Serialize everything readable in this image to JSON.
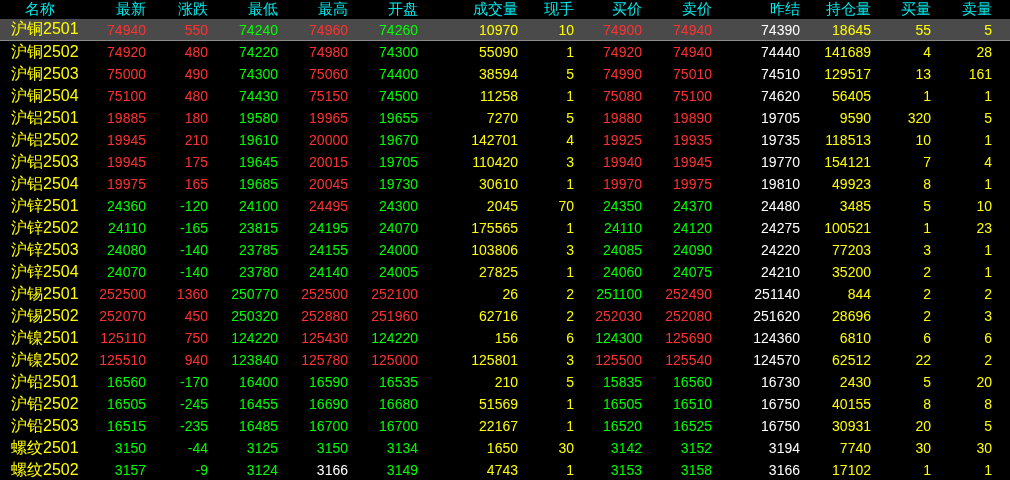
{
  "table": {
    "columns": [
      "名称",
      "最新",
      "涨跌",
      "最低",
      "最高",
      "开盘",
      "成交量",
      "现手",
      "买价",
      "卖价",
      "昨结",
      "持仓量",
      "买量",
      "卖量"
    ],
    "rows": [
      {
        "selected": true,
        "cells": [
          {
            "text": "沪铜2501"
          },
          {
            "text": "74940",
            "color": "#ff3232"
          },
          {
            "text": "550",
            "color": "#ff3232"
          },
          {
            "text": "74240",
            "color": "#00ff00"
          },
          {
            "text": "74960",
            "color": "#ff3232"
          },
          {
            "text": "74260",
            "color": "#00ff00"
          },
          {
            "text": "10970",
            "color": "#ffff00"
          },
          {
            "text": "10",
            "color": "#ffff00"
          },
          {
            "text": "74900",
            "color": "#ff3232"
          },
          {
            "text": "74940",
            "color": "#ff3232"
          },
          {
            "text": "74390",
            "color": "#ffffff"
          },
          {
            "text": "18645",
            "color": "#ffff00"
          },
          {
            "text": "55",
            "color": "#ffff00"
          },
          {
            "text": "5",
            "color": "#ffff00"
          }
        ]
      },
      {
        "selected": false,
        "cells": [
          {
            "text": "沪铜2502"
          },
          {
            "text": "74920",
            "color": "#ff3232"
          },
          {
            "text": "480",
            "color": "#ff3232"
          },
          {
            "text": "74220",
            "color": "#00ff00"
          },
          {
            "text": "74980",
            "color": "#ff3232"
          },
          {
            "text": "74300",
            "color": "#00ff00"
          },
          {
            "text": "55090",
            "color": "#ffff00"
          },
          {
            "text": "1",
            "color": "#ffff00"
          },
          {
            "text": "74920",
            "color": "#ff3232"
          },
          {
            "text": "74940",
            "color": "#ff3232"
          },
          {
            "text": "74440",
            "color": "#ffffff"
          },
          {
            "text": "141689",
            "color": "#ffff00"
          },
          {
            "text": "4",
            "color": "#ffff00"
          },
          {
            "text": "28",
            "color": "#ffff00"
          }
        ]
      },
      {
        "selected": false,
        "cells": [
          {
            "text": "沪铜2503"
          },
          {
            "text": "75000",
            "color": "#ff3232"
          },
          {
            "text": "490",
            "color": "#ff3232"
          },
          {
            "text": "74300",
            "color": "#00ff00"
          },
          {
            "text": "75060",
            "color": "#ff3232"
          },
          {
            "text": "74400",
            "color": "#00ff00"
          },
          {
            "text": "38594",
            "color": "#ffff00"
          },
          {
            "text": "5",
            "color": "#ffff00"
          },
          {
            "text": "74990",
            "color": "#ff3232"
          },
          {
            "text": "75010",
            "color": "#ff3232"
          },
          {
            "text": "74510",
            "color": "#ffffff"
          },
          {
            "text": "129517",
            "color": "#ffff00"
          },
          {
            "text": "13",
            "color": "#ffff00"
          },
          {
            "text": "161",
            "color": "#ffff00"
          }
        ]
      },
      {
        "selected": false,
        "cells": [
          {
            "text": "沪铜2504"
          },
          {
            "text": "75100",
            "color": "#ff3232"
          },
          {
            "text": "480",
            "color": "#ff3232"
          },
          {
            "text": "74430",
            "color": "#00ff00"
          },
          {
            "text": "75150",
            "color": "#ff3232"
          },
          {
            "text": "74500",
            "color": "#00ff00"
          },
          {
            "text": "11258",
            "color": "#ffff00"
          },
          {
            "text": "1",
            "color": "#ffff00"
          },
          {
            "text": "75080",
            "color": "#ff3232"
          },
          {
            "text": "75100",
            "color": "#ff3232"
          },
          {
            "text": "74620",
            "color": "#ffffff"
          },
          {
            "text": "56405",
            "color": "#ffff00"
          },
          {
            "text": "1",
            "color": "#ffff00"
          },
          {
            "text": "1",
            "color": "#ffff00"
          }
        ]
      },
      {
        "selected": false,
        "cells": [
          {
            "text": "沪铝2501"
          },
          {
            "text": "19885",
            "color": "#ff3232"
          },
          {
            "text": "180",
            "color": "#ff3232"
          },
          {
            "text": "19580",
            "color": "#00ff00"
          },
          {
            "text": "19965",
            "color": "#ff3232"
          },
          {
            "text": "19655",
            "color": "#00ff00"
          },
          {
            "text": "7270",
            "color": "#ffff00"
          },
          {
            "text": "5",
            "color": "#ffff00"
          },
          {
            "text": "19880",
            "color": "#ff3232"
          },
          {
            "text": "19890",
            "color": "#ff3232"
          },
          {
            "text": "19705",
            "color": "#ffffff"
          },
          {
            "text": "9590",
            "color": "#ffff00"
          },
          {
            "text": "320",
            "color": "#ffff00"
          },
          {
            "text": "5",
            "color": "#ffff00"
          }
        ]
      },
      {
        "selected": false,
        "cells": [
          {
            "text": "沪铝2502"
          },
          {
            "text": "19945",
            "color": "#ff3232"
          },
          {
            "text": "210",
            "color": "#ff3232"
          },
          {
            "text": "19610",
            "color": "#00ff00"
          },
          {
            "text": "20000",
            "color": "#ff3232"
          },
          {
            "text": "19670",
            "color": "#00ff00"
          },
          {
            "text": "142701",
            "color": "#ffff00"
          },
          {
            "text": "4",
            "color": "#ffff00"
          },
          {
            "text": "19925",
            "color": "#ff3232"
          },
          {
            "text": "19935",
            "color": "#ff3232"
          },
          {
            "text": "19735",
            "color": "#ffffff"
          },
          {
            "text": "118513",
            "color": "#ffff00"
          },
          {
            "text": "10",
            "color": "#ffff00"
          },
          {
            "text": "1",
            "color": "#ffff00"
          }
        ]
      },
      {
        "selected": false,
        "cells": [
          {
            "text": "沪铝2503"
          },
          {
            "text": "19945",
            "color": "#ff3232"
          },
          {
            "text": "175",
            "color": "#ff3232"
          },
          {
            "text": "19645",
            "color": "#00ff00"
          },
          {
            "text": "20015",
            "color": "#ff3232"
          },
          {
            "text": "19705",
            "color": "#00ff00"
          },
          {
            "text": "110420",
            "color": "#ffff00"
          },
          {
            "text": "3",
            "color": "#ffff00"
          },
          {
            "text": "19940",
            "color": "#ff3232"
          },
          {
            "text": "19945",
            "color": "#ff3232"
          },
          {
            "text": "19770",
            "color": "#ffffff"
          },
          {
            "text": "154121",
            "color": "#ffff00"
          },
          {
            "text": "7",
            "color": "#ffff00"
          },
          {
            "text": "4",
            "color": "#ffff00"
          }
        ]
      },
      {
        "selected": false,
        "cells": [
          {
            "text": "沪铝2504"
          },
          {
            "text": "19975",
            "color": "#ff3232"
          },
          {
            "text": "165",
            "color": "#ff3232"
          },
          {
            "text": "19685",
            "color": "#00ff00"
          },
          {
            "text": "20045",
            "color": "#ff3232"
          },
          {
            "text": "19730",
            "color": "#00ff00"
          },
          {
            "text": "30610",
            "color": "#ffff00"
          },
          {
            "text": "1",
            "color": "#ffff00"
          },
          {
            "text": "19970",
            "color": "#ff3232"
          },
          {
            "text": "19975",
            "color": "#ff3232"
          },
          {
            "text": "19810",
            "color": "#ffffff"
          },
          {
            "text": "49923",
            "color": "#ffff00"
          },
          {
            "text": "8",
            "color": "#ffff00"
          },
          {
            "text": "1",
            "color": "#ffff00"
          }
        ]
      },
      {
        "selected": false,
        "cells": [
          {
            "text": "沪锌2501"
          },
          {
            "text": "24360",
            "color": "#00ff00"
          },
          {
            "text": "-120",
            "color": "#00ff00"
          },
          {
            "text": "24100",
            "color": "#00ff00"
          },
          {
            "text": "24495",
            "color": "#ff3232"
          },
          {
            "text": "24300",
            "color": "#00ff00"
          },
          {
            "text": "2045",
            "color": "#ffff00"
          },
          {
            "text": "70",
            "color": "#ffff00"
          },
          {
            "text": "24350",
            "color": "#00ff00"
          },
          {
            "text": "24370",
            "color": "#00ff00"
          },
          {
            "text": "24480",
            "color": "#ffffff"
          },
          {
            "text": "3485",
            "color": "#ffff00"
          },
          {
            "text": "5",
            "color": "#ffff00"
          },
          {
            "text": "10",
            "color": "#ffff00"
          }
        ]
      },
      {
        "selected": false,
        "cells": [
          {
            "text": "沪锌2502"
          },
          {
            "text": "24110",
            "color": "#00ff00"
          },
          {
            "text": "-165",
            "color": "#00ff00"
          },
          {
            "text": "23815",
            "color": "#00ff00"
          },
          {
            "text": "24195",
            "color": "#00ff00"
          },
          {
            "text": "24070",
            "color": "#00ff00"
          },
          {
            "text": "175565",
            "color": "#ffff00"
          },
          {
            "text": "1",
            "color": "#ffff00"
          },
          {
            "text": "24110",
            "color": "#00ff00"
          },
          {
            "text": "24120",
            "color": "#00ff00"
          },
          {
            "text": "24275",
            "color": "#ffffff"
          },
          {
            "text": "100521",
            "color": "#ffff00"
          },
          {
            "text": "1",
            "color": "#ffff00"
          },
          {
            "text": "23",
            "color": "#ffff00"
          }
        ]
      },
      {
        "selected": false,
        "cells": [
          {
            "text": "沪锌2503"
          },
          {
            "text": "24080",
            "color": "#00ff00"
          },
          {
            "text": "-140",
            "color": "#00ff00"
          },
          {
            "text": "23785",
            "color": "#00ff00"
          },
          {
            "text": "24155",
            "color": "#00ff00"
          },
          {
            "text": "24000",
            "color": "#00ff00"
          },
          {
            "text": "103806",
            "color": "#ffff00"
          },
          {
            "text": "3",
            "color": "#ffff00"
          },
          {
            "text": "24085",
            "color": "#00ff00"
          },
          {
            "text": "24090",
            "color": "#00ff00"
          },
          {
            "text": "24220",
            "color": "#ffffff"
          },
          {
            "text": "77203",
            "color": "#ffff00"
          },
          {
            "text": "3",
            "color": "#ffff00"
          },
          {
            "text": "1",
            "color": "#ffff00"
          }
        ]
      },
      {
        "selected": false,
        "cells": [
          {
            "text": "沪锌2504"
          },
          {
            "text": "24070",
            "color": "#00ff00"
          },
          {
            "text": "-140",
            "color": "#00ff00"
          },
          {
            "text": "23780",
            "color": "#00ff00"
          },
          {
            "text": "24140",
            "color": "#00ff00"
          },
          {
            "text": "24005",
            "color": "#00ff00"
          },
          {
            "text": "27825",
            "color": "#ffff00"
          },
          {
            "text": "1",
            "color": "#ffff00"
          },
          {
            "text": "24060",
            "color": "#00ff00"
          },
          {
            "text": "24075",
            "color": "#00ff00"
          },
          {
            "text": "24210",
            "color": "#ffffff"
          },
          {
            "text": "35200",
            "color": "#ffff00"
          },
          {
            "text": "2",
            "color": "#ffff00"
          },
          {
            "text": "1",
            "color": "#ffff00"
          }
        ]
      },
      {
        "selected": false,
        "cells": [
          {
            "text": "沪锡2501"
          },
          {
            "text": "252500",
            "color": "#ff3232"
          },
          {
            "text": "1360",
            "color": "#ff3232"
          },
          {
            "text": "250770",
            "color": "#00ff00"
          },
          {
            "text": "252500",
            "color": "#ff3232"
          },
          {
            "text": "252100",
            "color": "#ff3232"
          },
          {
            "text": "26",
            "color": "#ffff00"
          },
          {
            "text": "2",
            "color": "#ffff00"
          },
          {
            "text": "251100",
            "color": "#00ff00"
          },
          {
            "text": "252490",
            "color": "#ff3232"
          },
          {
            "text": "251140",
            "color": "#ffffff"
          },
          {
            "text": "844",
            "color": "#ffff00"
          },
          {
            "text": "2",
            "color": "#ffff00"
          },
          {
            "text": "2",
            "color": "#ffff00"
          }
        ]
      },
      {
        "selected": false,
        "cells": [
          {
            "text": "沪锡2502"
          },
          {
            "text": "252070",
            "color": "#ff3232"
          },
          {
            "text": "450",
            "color": "#ff3232"
          },
          {
            "text": "250320",
            "color": "#00ff00"
          },
          {
            "text": "252880",
            "color": "#ff3232"
          },
          {
            "text": "251960",
            "color": "#ff3232"
          },
          {
            "text": "62716",
            "color": "#ffff00"
          },
          {
            "text": "2",
            "color": "#ffff00"
          },
          {
            "text": "252030",
            "color": "#ff3232"
          },
          {
            "text": "252080",
            "color": "#ff3232"
          },
          {
            "text": "251620",
            "color": "#ffffff"
          },
          {
            "text": "28696",
            "color": "#ffff00"
          },
          {
            "text": "2",
            "color": "#ffff00"
          },
          {
            "text": "3",
            "color": "#ffff00"
          }
        ]
      },
      {
        "selected": false,
        "cells": [
          {
            "text": "沪镍2501"
          },
          {
            "text": "125110",
            "color": "#ff3232"
          },
          {
            "text": "750",
            "color": "#ff3232"
          },
          {
            "text": "124220",
            "color": "#00ff00"
          },
          {
            "text": "125430",
            "color": "#ff3232"
          },
          {
            "text": "124220",
            "color": "#00ff00"
          },
          {
            "text": "156",
            "color": "#ffff00"
          },
          {
            "text": "6",
            "color": "#ffff00"
          },
          {
            "text": "124300",
            "color": "#00ff00"
          },
          {
            "text": "125690",
            "color": "#ff3232"
          },
          {
            "text": "124360",
            "color": "#ffffff"
          },
          {
            "text": "6810",
            "color": "#ffff00"
          },
          {
            "text": "6",
            "color": "#ffff00"
          },
          {
            "text": "6",
            "color": "#ffff00"
          }
        ]
      },
      {
        "selected": false,
        "cells": [
          {
            "text": "沪镍2502"
          },
          {
            "text": "125510",
            "color": "#ff3232"
          },
          {
            "text": "940",
            "color": "#ff3232"
          },
          {
            "text": "123840",
            "color": "#00ff00"
          },
          {
            "text": "125780",
            "color": "#ff3232"
          },
          {
            "text": "125000",
            "color": "#ff3232"
          },
          {
            "text": "125801",
            "color": "#ffff00"
          },
          {
            "text": "3",
            "color": "#ffff00"
          },
          {
            "text": "125500",
            "color": "#ff3232"
          },
          {
            "text": "125540",
            "color": "#ff3232"
          },
          {
            "text": "124570",
            "color": "#ffffff"
          },
          {
            "text": "62512",
            "color": "#ffff00"
          },
          {
            "text": "22",
            "color": "#ffff00"
          },
          {
            "text": "2",
            "color": "#ffff00"
          }
        ]
      },
      {
        "selected": false,
        "cells": [
          {
            "text": "沪铅2501"
          },
          {
            "text": "16560",
            "color": "#00ff00"
          },
          {
            "text": "-170",
            "color": "#00ff00"
          },
          {
            "text": "16400",
            "color": "#00ff00"
          },
          {
            "text": "16590",
            "color": "#00ff00"
          },
          {
            "text": "16535",
            "color": "#00ff00"
          },
          {
            "text": "210",
            "color": "#ffff00"
          },
          {
            "text": "5",
            "color": "#ffff00"
          },
          {
            "text": "15835",
            "color": "#00ff00"
          },
          {
            "text": "16560",
            "color": "#00ff00"
          },
          {
            "text": "16730",
            "color": "#ffffff"
          },
          {
            "text": "2430",
            "color": "#ffff00"
          },
          {
            "text": "5",
            "color": "#ffff00"
          },
          {
            "text": "20",
            "color": "#ffff00"
          }
        ]
      },
      {
        "selected": false,
        "cells": [
          {
            "text": "沪铅2502"
          },
          {
            "text": "16505",
            "color": "#00ff00"
          },
          {
            "text": "-245",
            "color": "#00ff00"
          },
          {
            "text": "16455",
            "color": "#00ff00"
          },
          {
            "text": "16690",
            "color": "#00ff00"
          },
          {
            "text": "16680",
            "color": "#00ff00"
          },
          {
            "text": "51569",
            "color": "#ffff00"
          },
          {
            "text": "1",
            "color": "#ffff00"
          },
          {
            "text": "16505",
            "color": "#00ff00"
          },
          {
            "text": "16510",
            "color": "#00ff00"
          },
          {
            "text": "16750",
            "color": "#ffffff"
          },
          {
            "text": "40155",
            "color": "#ffff00"
          },
          {
            "text": "8",
            "color": "#ffff00"
          },
          {
            "text": "8",
            "color": "#ffff00"
          }
        ]
      },
      {
        "selected": false,
        "cells": [
          {
            "text": "沪铅2503"
          },
          {
            "text": "16515",
            "color": "#00ff00"
          },
          {
            "text": "-235",
            "color": "#00ff00"
          },
          {
            "text": "16485",
            "color": "#00ff00"
          },
          {
            "text": "16700",
            "color": "#00ff00"
          },
          {
            "text": "16700",
            "color": "#00ff00"
          },
          {
            "text": "22167",
            "color": "#ffff00"
          },
          {
            "text": "1",
            "color": "#ffff00"
          },
          {
            "text": "16520",
            "color": "#00ff00"
          },
          {
            "text": "16525",
            "color": "#00ff00"
          },
          {
            "text": "16750",
            "color": "#ffffff"
          },
          {
            "text": "30931",
            "color": "#ffff00"
          },
          {
            "text": "20",
            "color": "#ffff00"
          },
          {
            "text": "5",
            "color": "#ffff00"
          }
        ]
      },
      {
        "selected": false,
        "cells": [
          {
            "text": "螺纹2501"
          },
          {
            "text": "3150",
            "color": "#00ff00"
          },
          {
            "text": "-44",
            "color": "#00ff00"
          },
          {
            "text": "3125",
            "color": "#00ff00"
          },
          {
            "text": "3150",
            "color": "#00ff00"
          },
          {
            "text": "3134",
            "color": "#00ff00"
          },
          {
            "text": "1650",
            "color": "#ffff00"
          },
          {
            "text": "30",
            "color": "#ffff00"
          },
          {
            "text": "3142",
            "color": "#00ff00"
          },
          {
            "text": "3152",
            "color": "#00ff00"
          },
          {
            "text": "3194",
            "color": "#ffffff"
          },
          {
            "text": "7740",
            "color": "#ffff00"
          },
          {
            "text": "30",
            "color": "#ffff00"
          },
          {
            "text": "30",
            "color": "#ffff00"
          }
        ]
      },
      {
        "selected": false,
        "cells": [
          {
            "text": "螺纹2502"
          },
          {
            "text": "3157",
            "color": "#00ff00"
          },
          {
            "text": "-9",
            "color": "#00ff00"
          },
          {
            "text": "3124",
            "color": "#00ff00"
          },
          {
            "text": "3166",
            "color": "#ffffff"
          },
          {
            "text": "3149",
            "color": "#00ff00"
          },
          {
            "text": "4743",
            "color": "#ffff00"
          },
          {
            "text": "1",
            "color": "#ffff00"
          },
          {
            "text": "3153",
            "color": "#00ff00"
          },
          {
            "text": "3158",
            "color": "#00ff00"
          },
          {
            "text": "3166",
            "color": "#ffffff"
          },
          {
            "text": "17102",
            "color": "#ffff00"
          },
          {
            "text": "1",
            "color": "#ffff00"
          },
          {
            "text": "1",
            "color": "#ffff00"
          }
        ]
      }
    ]
  }
}
